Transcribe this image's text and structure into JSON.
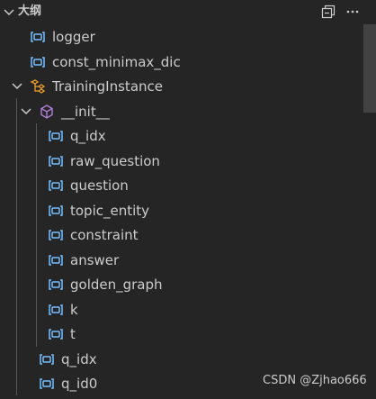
{
  "header": {
    "title": "大纲",
    "collapse_icon": "chevron-down-icon",
    "collapse_all_icon": "collapse-all-icon",
    "more_icon": "ellipsis-icon"
  },
  "tree": [
    {
      "label": "logger",
      "icon": "variable-icon",
      "level": 1
    },
    {
      "label": "const_minimax_dic",
      "icon": "variable-icon",
      "level": 1
    },
    {
      "label": "TrainingInstance",
      "icon": "class-icon",
      "level": 0,
      "expanded": true
    },
    {
      "label": "__init__",
      "icon": "method-icon",
      "level": 1,
      "expanded": true
    },
    {
      "label": "q_idx",
      "icon": "variable-icon",
      "level": 2
    },
    {
      "label": "raw_question",
      "icon": "variable-icon",
      "level": 2
    },
    {
      "label": "question",
      "icon": "variable-icon",
      "level": 2
    },
    {
      "label": "topic_entity",
      "icon": "variable-icon",
      "level": 2
    },
    {
      "label": "constraint",
      "icon": "variable-icon",
      "level": 2
    },
    {
      "label": "answer",
      "icon": "variable-icon",
      "level": 2
    },
    {
      "label": "golden_graph",
      "icon": "variable-icon",
      "level": 2
    },
    {
      "label": "k",
      "icon": "variable-icon",
      "level": 2
    },
    {
      "label": "t",
      "icon": "variable-icon",
      "level": 2
    },
    {
      "label": "q_idx",
      "icon": "variable-icon",
      "level": 1
    },
    {
      "label": "q_id0",
      "icon": "variable-icon",
      "level": 1
    }
  ],
  "watermark": "CSDN @Zjhao666",
  "colors": {
    "background": "#252526",
    "text": "#cccccc",
    "variable_icon": "#75beff",
    "class_icon": "#ee9d28",
    "method_icon": "#b180d7"
  }
}
